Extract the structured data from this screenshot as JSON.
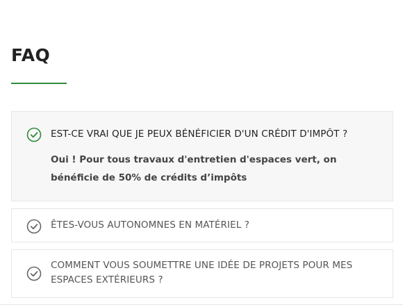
{
  "faq": {
    "title": "FAQ",
    "accent_color": "#2f8a3a",
    "items": [
      {
        "question": "EST-CE VRAI QUE JE PEUX BÉNÉFICIER D'UN CRÉDIT D'IMPÔT ?",
        "answer": "Oui ! Pour tous travaux d'entretien d'espaces vert, on bénéficie de 50% de crédits d’impôts",
        "expanded": true,
        "icon": "check-circle-icon"
      },
      {
        "question": "ÊTES-VOUS AUTONOMNES EN MATÉRIEL ?",
        "expanded": false,
        "icon": "check-circle-icon"
      },
      {
        "question": "COMMENT VOUS SOUMETTRE UNE IDÉE DE PROJETS POUR MES ESPACES EXTÉRIEURS ?",
        "expanded": false,
        "icon": "check-circle-icon"
      }
    ]
  }
}
